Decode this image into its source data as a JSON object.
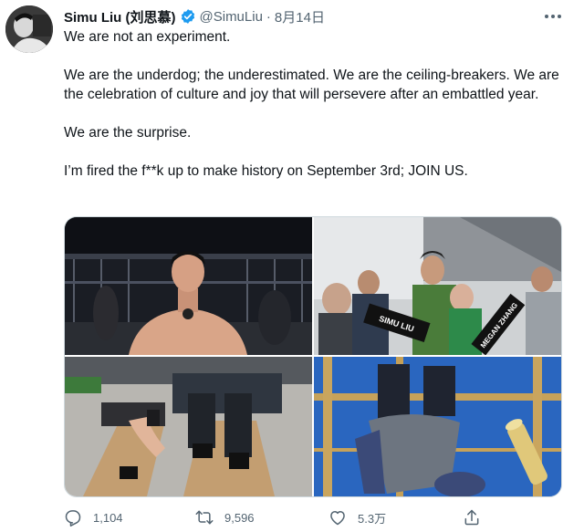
{
  "tweet": {
    "display_name": "Simu Liu (刘思慕)",
    "handle": "@SimuLiu",
    "separator": "·",
    "date": "8月14日",
    "paragraphs": [
      "We are not an experiment.",
      "We are the underdog; the underestimated. We are the ceiling-breakers. We are the celebration of culture and joy that will persevere after an embattled year.",
      "We are the surprise.",
      "I’m fired the f**k up to make history on September 3rd; JOIN US."
    ],
    "photos": {
      "banner_left": "SIMU LIU",
      "banner_right": "MEGAN ZHANG"
    },
    "stats": {
      "replies": "1,104",
      "retweets": "9,596",
      "likes": "5.3万"
    }
  },
  "colors": {
    "verified": "#1d9bf0",
    "muted_text": "#536471",
    "text": "#0f1419",
    "border": "#cfd9de"
  },
  "icons": [
    "verified-badge-icon",
    "more-options-icon",
    "reply-icon",
    "retweet-icon",
    "like-icon",
    "share-icon"
  ]
}
